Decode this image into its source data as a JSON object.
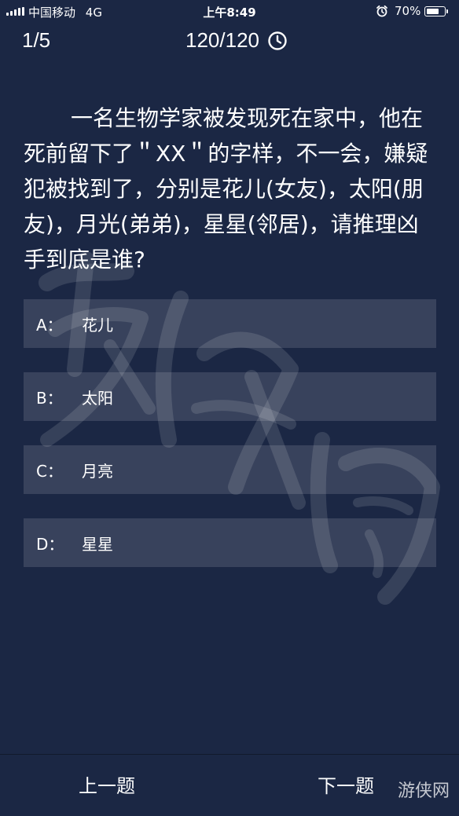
{
  "status_bar": {
    "carrier": "中国移动",
    "network": "4G",
    "time": "上午8:49",
    "battery": "70%",
    "battery_level": 0.7
  },
  "header": {
    "progress": "1/5",
    "timer": "120/120",
    "timer_icon": "clock-icon"
  },
  "question": {
    "text": "一名生物学家被发现死在家中，他在死前留下了＂XX＂的字样，不一会，嫌疑犯被找到了，分别是花儿(女友)，太阳(朋友)，月光(弟弟)，星星(邻居)，请推理凶手到底是谁?"
  },
  "options": [
    {
      "letter": "A：",
      "text": "花儿"
    },
    {
      "letter": "B：",
      "text": "太阳"
    },
    {
      "letter": "C：",
      "text": "月亮"
    },
    {
      "letter": "D：",
      "text": "星星"
    }
  ],
  "nav": {
    "prev": "上一题",
    "next": "下一题"
  },
  "watermark": {
    "text": "游侠网"
  }
}
